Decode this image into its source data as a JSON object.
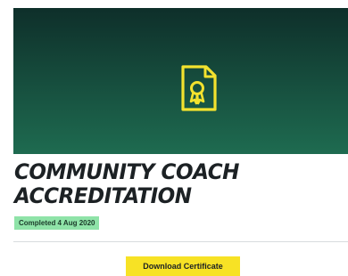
{
  "course": {
    "title": "COMMUNITY COACH ACCREDITATION",
    "title_line1": "COMMUNITY COACH",
    "title_line2": "ACCREDITATION",
    "status": "Completed 4 Aug 2020"
  },
  "actions": {
    "download_label": "Download Certificate"
  },
  "icons": {
    "banner_icon": "certificate-icon"
  },
  "colors": {
    "banner_dark": "#0e2f2a",
    "banner_light": "#1e6b50",
    "icon_accent": "#f3e22e",
    "badge_bg": "#8fe3a8",
    "button_bg": "#f7e225",
    "title_text": "#1c2124"
  }
}
